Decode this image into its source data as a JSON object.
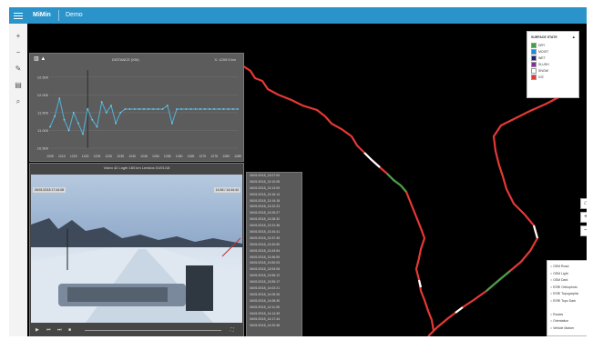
{
  "app": {
    "name": "MiMin",
    "page": "Demo"
  },
  "chart": {
    "title": "DISTANCE (KM)",
    "right_label": "X: 1209.5 km",
    "y_ticks": [
      "12.500",
      "12.000",
      "11.500",
      "11.000",
      "10.500"
    ],
    "x_ticks": [
      "1205",
      "1210",
      "1215",
      "1220",
      "1225",
      "1230",
      "1235",
      "1240",
      "1245",
      "1250",
      "1255",
      "1260",
      "1265",
      "1270",
      "1275",
      "1280",
      "1285"
    ],
    "chart_data": {
      "type": "line",
      "title": "DISTANCE (KM)",
      "xlabel": "",
      "ylabel": "",
      "x": [
        1205,
        1207,
        1209,
        1211,
        1213,
        1215,
        1217,
        1219,
        1221,
        1223,
        1225,
        1227,
        1229,
        1231,
        1233,
        1235,
        1237,
        1239,
        1241,
        1243,
        1245,
        1247,
        1249,
        1251,
        1253,
        1255,
        1257,
        1259,
        1261,
        1263,
        1265,
        1267,
        1269,
        1271,
        1273,
        1275,
        1277,
        1279,
        1281,
        1283,
        1285
      ],
      "y": [
        11.1,
        11.4,
        11.9,
        11.3,
        11.0,
        11.5,
        11.2,
        10.9,
        11.6,
        11.3,
        11.1,
        11.8,
        11.5,
        11.7,
        11.2,
        11.5,
        11.6,
        11.6,
        11.6,
        11.6,
        11.6,
        11.6,
        11.6,
        11.6,
        11.6,
        11.7,
        11.2,
        11.6,
        11.6,
        11.6,
        11.6,
        11.6,
        11.6,
        11.6,
        11.6,
        11.6,
        11.6,
        11.6,
        11.6,
        11.6,
        11.6
      ],
      "ylim": [
        10.5,
        12.7
      ],
      "grid": true
    }
  },
  "video": {
    "title": "Video 42 Lngth 160 km Lenklos 01/01/18",
    "left_stamp": "06/01/2018 17:44:08",
    "right_stamp": "14:36 / 14:44:44",
    "controls": [
      "play",
      "prev",
      "next",
      "stop",
      "fullscreen"
    ]
  },
  "timeline": {
    "entries": [
      "06/01/2018_13:07:00",
      "06/01/2018_13:10:05",
      "06/01/2018_13:13:09",
      "06/01/2018_13:16:14",
      "06/01/2018_13:19:18",
      "06/01/2018_13:22:23",
      "06/01/2018_13:25:27",
      "06/01/2018_13:28:32",
      "06/01/2018_13:31:36",
      "06/01/2018_13:34:41",
      "06/01/2018_13:37:45",
      "06/01/2018_13:40:50",
      "06/01/2018_13:43:54",
      "06/01/2018_13:46:59",
      "06/01/2018_13:50:03",
      "06/01/2018_13:53:08",
      "06/01/2018_13:56:12",
      "06/01/2018_13:59:17",
      "06/01/2018_14:02:21",
      "06/01/2018_14:05:26",
      "06/01/2018_14:08:30",
      "06/01/2018_14:11:35",
      "06/01/2018_14:14:39",
      "06/01/2018_14:17:44",
      "06/01/2018_14:20:48"
    ]
  },
  "legend": {
    "title": "SURFACE STATE",
    "items": [
      {
        "label": "DRY",
        "color": "#43a047"
      },
      {
        "label": "MOIST",
        "color": "#1e88e5"
      },
      {
        "label": "WET",
        "color": "#1a237e"
      },
      {
        "label": "SLUSH",
        "color": "#8e24aa"
      },
      {
        "label": "SNOW",
        "color": "#ffffff"
      },
      {
        "label": "ICE",
        "color": "#e53935"
      }
    ]
  },
  "layers": {
    "items": [
      "OSM Road",
      "OSM Light",
      "OSM Dark",
      "ESRI Orthophoto",
      "ESRI Topographic",
      "ESRI Topo Dark",
      "",
      "Routes",
      "Orientation",
      "Vehicle Marker"
    ]
  },
  "colors": {
    "topbar": "#2a93c9",
    "route_main": "#e53935",
    "route_snow": "#ffffff",
    "route_dry": "#43a047"
  }
}
